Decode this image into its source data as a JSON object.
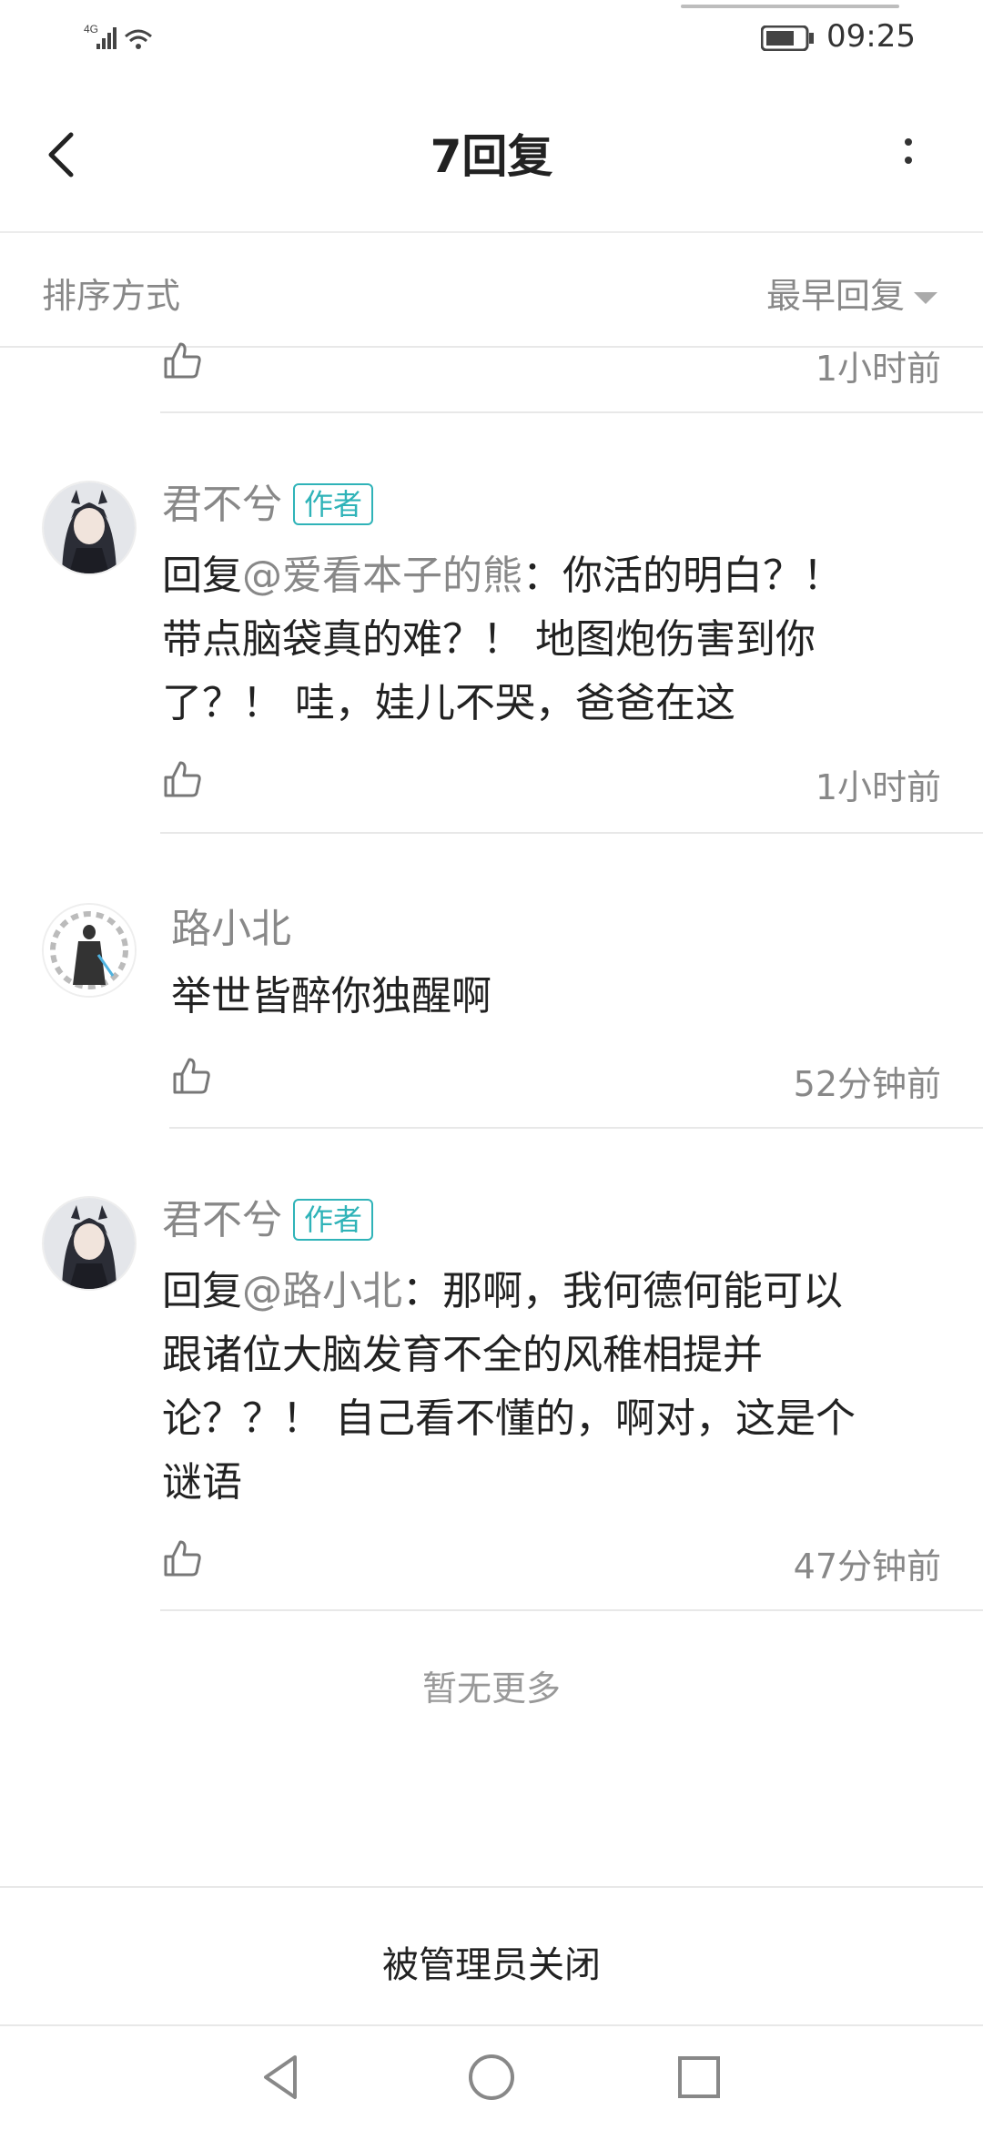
{
  "status_bar": {
    "network": "4G",
    "time": "09:25"
  },
  "header": {
    "title": "7回复",
    "back_icon": "chevron-left-icon",
    "more_icon": "more-vertical-icon"
  },
  "sort": {
    "label": "排序方式",
    "selected": "最早回复"
  },
  "comments": [
    {
      "time": "1小时前"
    },
    {
      "username": "君不兮",
      "badge": "作者",
      "reply_prefix": "回复",
      "mention": "@爱看本子的熊",
      "separator": "：",
      "lines": [
        "你活的明白？！",
        "带点脑袋真的难？！ 地图炮伤害到你",
        "了？！ 哇，娃儿不哭，爸爸在这"
      ],
      "time": "1小时前"
    },
    {
      "username": "路小北",
      "text": "举世皆醉你独醒啊",
      "time": "52分钟前"
    },
    {
      "username": "君不兮",
      "badge": "作者",
      "reply_prefix": "回复",
      "mention": "@路小北",
      "separator": "：",
      "lines": [
        "那啊，我何德何能可以",
        "跟诸位大脑发育不全的风稚相提并",
        "论？？！ 自己看不懂的，啊对，这是个",
        "谜语"
      ],
      "time": "47分钟前"
    }
  ],
  "no_more": "暂无更多",
  "closed_notice": "被管理员关闭",
  "colors": {
    "accent": "#2fb3b8",
    "muted": "#888888",
    "divider": "#e8e8e8"
  }
}
